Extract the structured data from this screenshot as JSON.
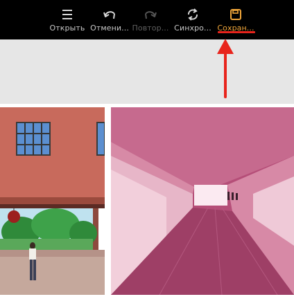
{
  "toolbar": {
    "items": [
      {
        "label": "Открыть",
        "icon": "menu-icon",
        "state": "normal"
      },
      {
        "label": "Отмени...",
        "icon": "undo-icon",
        "state": "normal"
      },
      {
        "label": "Повтор...",
        "icon": "redo-icon",
        "state": "disabled"
      },
      {
        "label": "Синхро...",
        "icon": "sync-icon",
        "state": "normal"
      },
      {
        "label": "Сохран...",
        "icon": "save-icon",
        "state": "active"
      }
    ]
  },
  "colors": {
    "toolbar_bg": "#000000",
    "active_accent": "#f0a63a",
    "annotation_red": "#e8241c",
    "banner_bg": "#e6e6e6"
  },
  "gallery": {
    "photos": [
      {
        "name": "street-building-photo"
      },
      {
        "name": "pink-underpass-photo"
      }
    ]
  }
}
